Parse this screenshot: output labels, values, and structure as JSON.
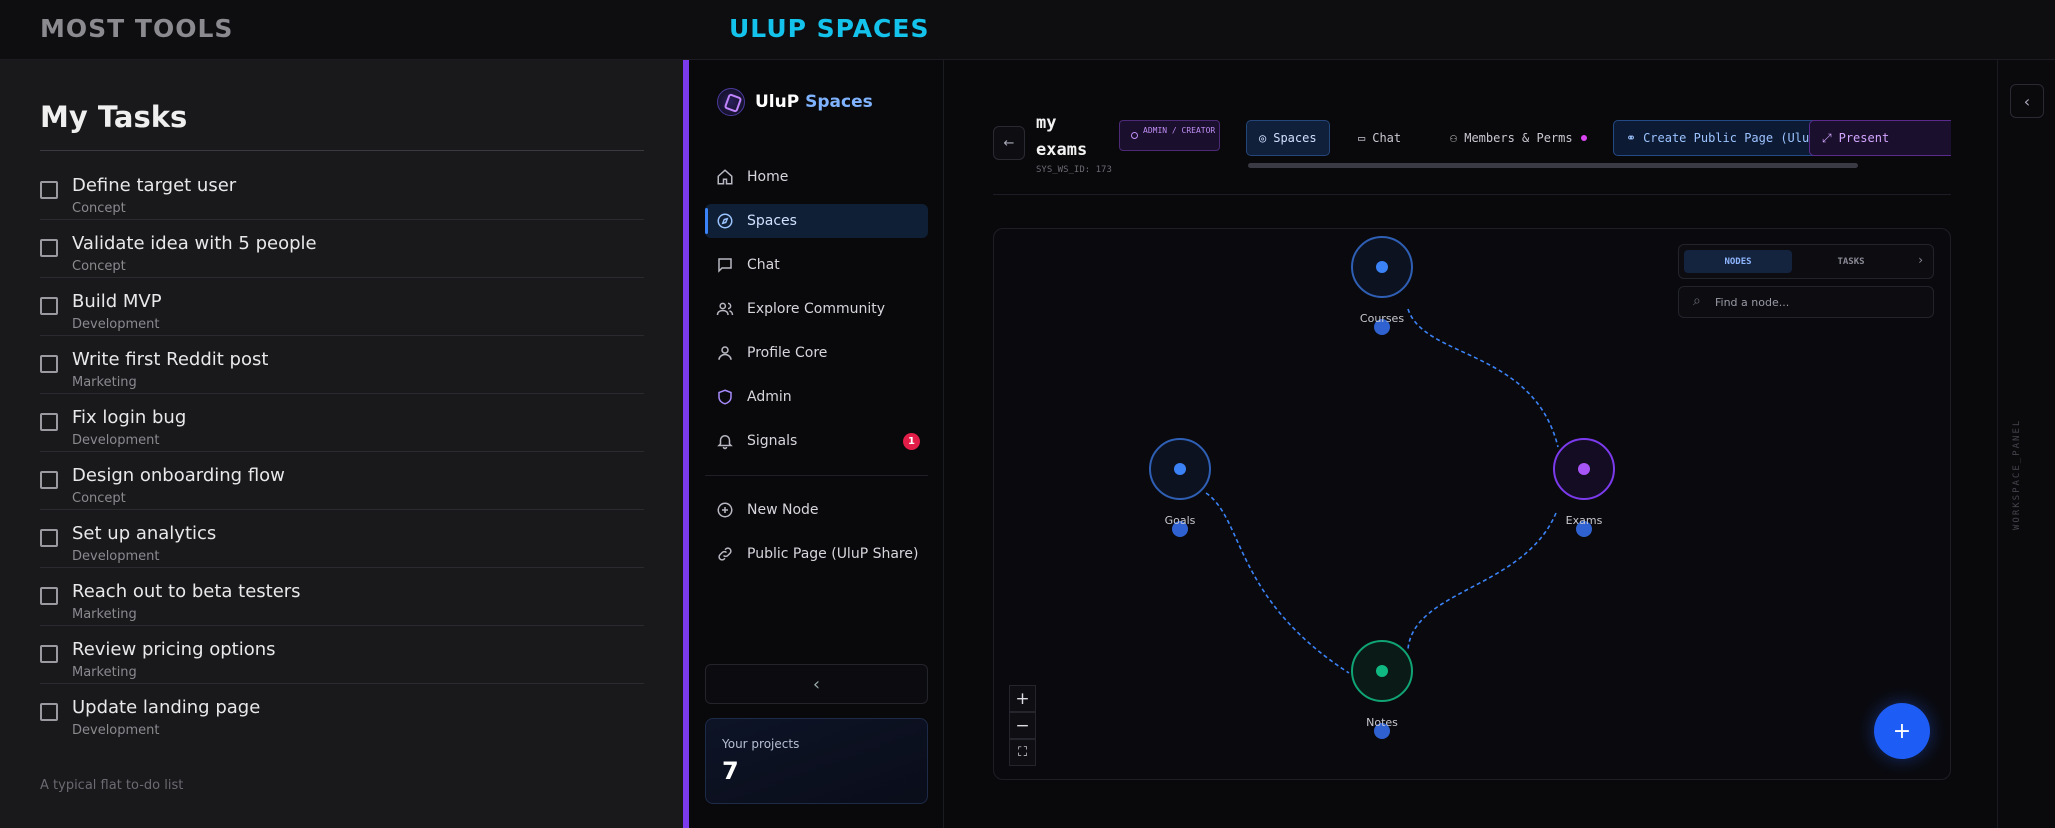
{
  "topbar": {
    "left_title": "MOST TOOLS",
    "right_title": "ULUP SPACES"
  },
  "tasks": {
    "title": "My Tasks",
    "items": [
      {
        "title": "Define target user",
        "category": "Concept"
      },
      {
        "title": "Validate idea with 5 people",
        "category": "Concept"
      },
      {
        "title": "Build MVP",
        "category": "Development"
      },
      {
        "title": "Write first Reddit post",
        "category": "Marketing"
      },
      {
        "title": "Fix login bug",
        "category": "Development"
      },
      {
        "title": "Design onboarding flow",
        "category": "Concept"
      },
      {
        "title": "Set up analytics",
        "category": "Development"
      },
      {
        "title": "Reach out to beta testers",
        "category": "Marketing"
      },
      {
        "title": "Review pricing options",
        "category": "Marketing"
      },
      {
        "title": "Update landing page",
        "category": "Development"
      }
    ],
    "footer": "A typical flat to-do list"
  },
  "sidebar": {
    "brand_a": "UluP",
    "brand_b": "Spaces",
    "items": [
      {
        "label": "Home",
        "icon": "home-icon"
      },
      {
        "label": "Spaces",
        "icon": "compass-icon"
      },
      {
        "label": "Chat",
        "icon": "chat-icon"
      },
      {
        "label": "Explore Community",
        "icon": "users-icon"
      },
      {
        "label": "Profile Core",
        "icon": "user-icon"
      },
      {
        "label": "Admin",
        "icon": "shield-icon"
      },
      {
        "label": "Signals",
        "icon": "bell-icon",
        "badge": "1"
      }
    ],
    "actions": [
      {
        "label": "New Node",
        "icon": "plus-circle-icon"
      },
      {
        "label": "Public Page (UluP Share)",
        "icon": "link-icon"
      }
    ],
    "projects_label": "Your projects",
    "projects_count": "7"
  },
  "workspace": {
    "title": "my exams",
    "id": "SYS_WS_ID: 173",
    "role": "ADMIN / CREATOR",
    "tabs": [
      {
        "label": "Spaces"
      },
      {
        "label": "Chat"
      },
      {
        "label": "Members & Perms"
      },
      {
        "label": "Create Public Page (UluP Share)"
      },
      {
        "label": "Present"
      }
    ],
    "panel_label": "WORKSPACE_PANEL"
  },
  "graph": {
    "panel_tabs": [
      "NODES",
      "TASKS"
    ],
    "find_placeholder": "Find a node...",
    "nodes": [
      {
        "label": "Courses",
        "color": "#3b82f6"
      },
      {
        "label": "Goals",
        "color": "#3b82f6"
      },
      {
        "label": "Exams",
        "color": "#a855f7"
      },
      {
        "label": "Notes",
        "color": "#10b981"
      }
    ],
    "fab": "+"
  },
  "colors": {
    "accent": "#7c3aed",
    "brand": "#14c3ec",
    "primary": "#1d5cf5"
  }
}
